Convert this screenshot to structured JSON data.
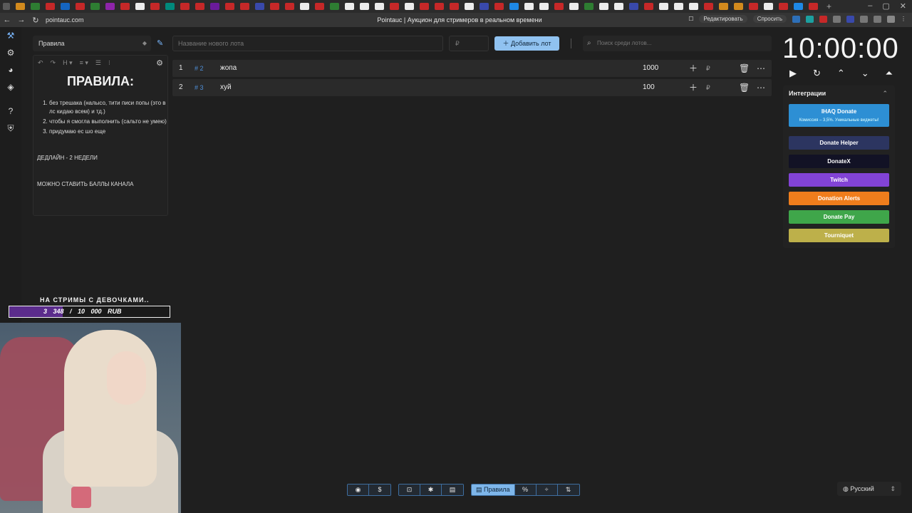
{
  "browser": {
    "url": "pointauc.com",
    "page_title": "Pointauc | Аукцион для стримеров в реальном времени",
    "edit_label": "Редактировать",
    "ask_label": "Спросить",
    "tab_colors": [
      "#d28a1d",
      "#2e7d32",
      "#c62828",
      "#1565c0",
      "#c62828",
      "#2e7d32",
      "#8e24aa",
      "#c62828",
      "#ececec",
      "#c62828",
      "#00897b",
      "#c62828",
      "#c62828",
      "#6a1b9a",
      "#c62828",
      "#c62828",
      "#3949ab",
      "#c62828",
      "#c62828",
      "#ececec",
      "#c62828",
      "#2e7d32",
      "#ececec",
      "#ececec",
      "#ececec",
      "#c62828",
      "#ececec",
      "#c62828",
      "#c62828",
      "#c62828",
      "#ececec",
      "#3949ab",
      "#c62828",
      "#1e88e5",
      "#ececec",
      "#ececec",
      "#c62828",
      "#ececec",
      "#2e7d32",
      "#ececec",
      "#ececec",
      "#3949ab",
      "#c62828",
      "#ececec",
      "#ececec",
      "#ececec",
      "#c62828",
      "#d28a1d",
      "#d28a1d",
      "#c62828",
      "#ececec",
      "#c62828",
      "#1e88e5",
      "#c62828"
    ]
  },
  "rules": {
    "select_label": "Правила",
    "title": "ПРАВИЛА:",
    "items": [
      "без трешака (налысо, тити писи попы (это в лс кидаю всем) и тд.)",
      "чтобы я смогла выполнить (сальто не умею)",
      "придумаю ес шо еще"
    ],
    "deadline": "ДЕДЛАЙН - 2 НЕДЕЛИ",
    "note": "МОЖНО СТАВИТЬ БАЛЛЫ КАНАЛА"
  },
  "controls": {
    "lot_placeholder": "Название нового лота",
    "amount_placeholder": "₽",
    "add_lot_label": "Добавить лот",
    "search_placeholder": "Поиск среди лотов..."
  },
  "lots": [
    {
      "index": "1",
      "tag": "# 2",
      "name": "жопа",
      "amount": "1000"
    },
    {
      "index": "2",
      "tag": "# 3",
      "name": "хуй",
      "amount": "100"
    }
  ],
  "timer": {
    "value": "10:00:00"
  },
  "integrations": {
    "header": "Интеграции",
    "ihaq_title": "IHAQ Donate",
    "ihaq_sub": "Комиссия – 3,5%. Уникальные виджеты!",
    "buttons": [
      {
        "label": "Donate Helper",
        "color": "#2c3560"
      },
      {
        "label": "DonateX",
        "color": "#121225"
      },
      {
        "label": "Twitch",
        "color": "#8243d6"
      },
      {
        "label": "Donation Alerts",
        "color": "#ef7d1c"
      },
      {
        "label": "Donate Pay",
        "color": "#3fa64a"
      },
      {
        "label": "Tourniquet",
        "color": "#bdb04a"
      }
    ]
  },
  "stream_overlay": {
    "title": "НА СТРИМЫ С ДЕВОЧКАМИ..",
    "goal_text": "3 348 / 10 000 RUB",
    "goal_progress": 0.3348
  },
  "bottom_toolbar": {
    "active_label": "Правила"
  },
  "language": {
    "selected": "Русский"
  }
}
